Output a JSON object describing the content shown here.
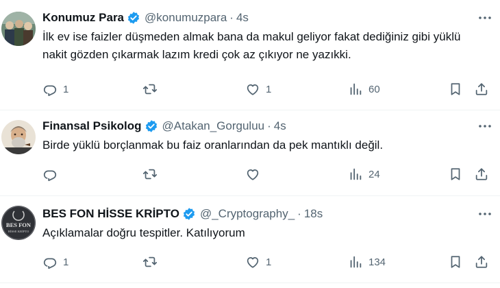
{
  "tweets": [
    {
      "name": "Konumuz Para",
      "handle": "@konumuzpara",
      "separator": "·",
      "time": "4s",
      "avatar_icon": "group-photo-avatar",
      "text": "İlk ev ise faizler düşmeden almak bana da makul geliyor fakat dediğiniz gibi yüklü nakit gözden çıkarmak lazım kredi çok az çıkıyor ne yazıkki.",
      "replies": "1",
      "retweets": "",
      "likes": "1",
      "views": "60"
    },
    {
      "name": "Finansal Psikolog",
      "handle": "@Atakan_Gorguluu",
      "separator": "·",
      "time": "4s",
      "avatar_icon": "portrait-avatar",
      "text": "Birde yüklü borçlanmak bu faiz oranlarından da pek mantıklı değil.",
      "replies": "",
      "retweets": "",
      "likes": "",
      "views": "24"
    },
    {
      "name": "BES FON HİSSE KRİPTO",
      "handle": "@_Cryptography_",
      "separator": "·",
      "time": "18s",
      "avatar_icon": "bes-fon-logo-avatar",
      "avatar_text_1": "BES FON",
      "avatar_text_2": "HİSSE KRİPTO",
      "text": "Açıklamalar doğru tespitler. Katılıyorum",
      "replies": "1",
      "retweets": "",
      "likes": "1",
      "views": "134"
    }
  ],
  "colors": {
    "verified": "#1d9bf0",
    "muted": "#536471",
    "text": "#0f1419",
    "divider": "#eff3f4"
  }
}
